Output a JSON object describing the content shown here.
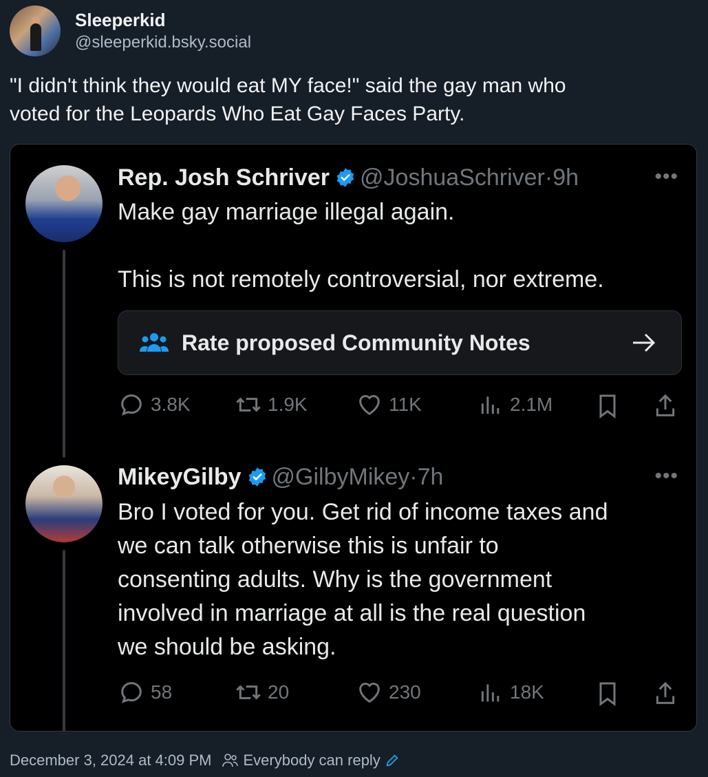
{
  "post": {
    "author_name": "Sleeperkid",
    "author_handle": "@sleeperkid.bsky.social",
    "text_line1": "\"I didn't think they would eat MY face!\" said the gay man who",
    "text_line2": "voted for the Leopards Who Eat Gay Faces Party.",
    "timestamp": "December 3, 2024 at 4:09 PM",
    "reply_setting": "Everybody can reply"
  },
  "embed": {
    "tweet1": {
      "name": "Rep. Josh Schriver",
      "handle": "@JoshuaSchriver",
      "sep": "·",
      "time": "9h",
      "line1": "Make gay marriage illegal again.",
      "line2": "This is not remotely controversial, nor extreme.",
      "notes_label": "Rate proposed Community Notes",
      "replies": "3.8K",
      "reposts": "1.9K",
      "likes": "11K",
      "views": "2.1M"
    },
    "tweet2": {
      "name": "MikeyGilby",
      "handle": "@GilbyMikey",
      "sep": "·",
      "time": "7h",
      "line1": "Bro I voted for you. Get rid of income taxes and",
      "line2": "we can talk otherwise this is unfair to",
      "line3": "consenting adults. Why is the government",
      "line4": "involved in marriage at all is the real question",
      "line5": "we should be asking.",
      "replies": "58",
      "reposts": "20",
      "likes": "230",
      "views": "18K"
    },
    "more_glyph": "•••",
    "verified_color": "#1d9bf0"
  }
}
